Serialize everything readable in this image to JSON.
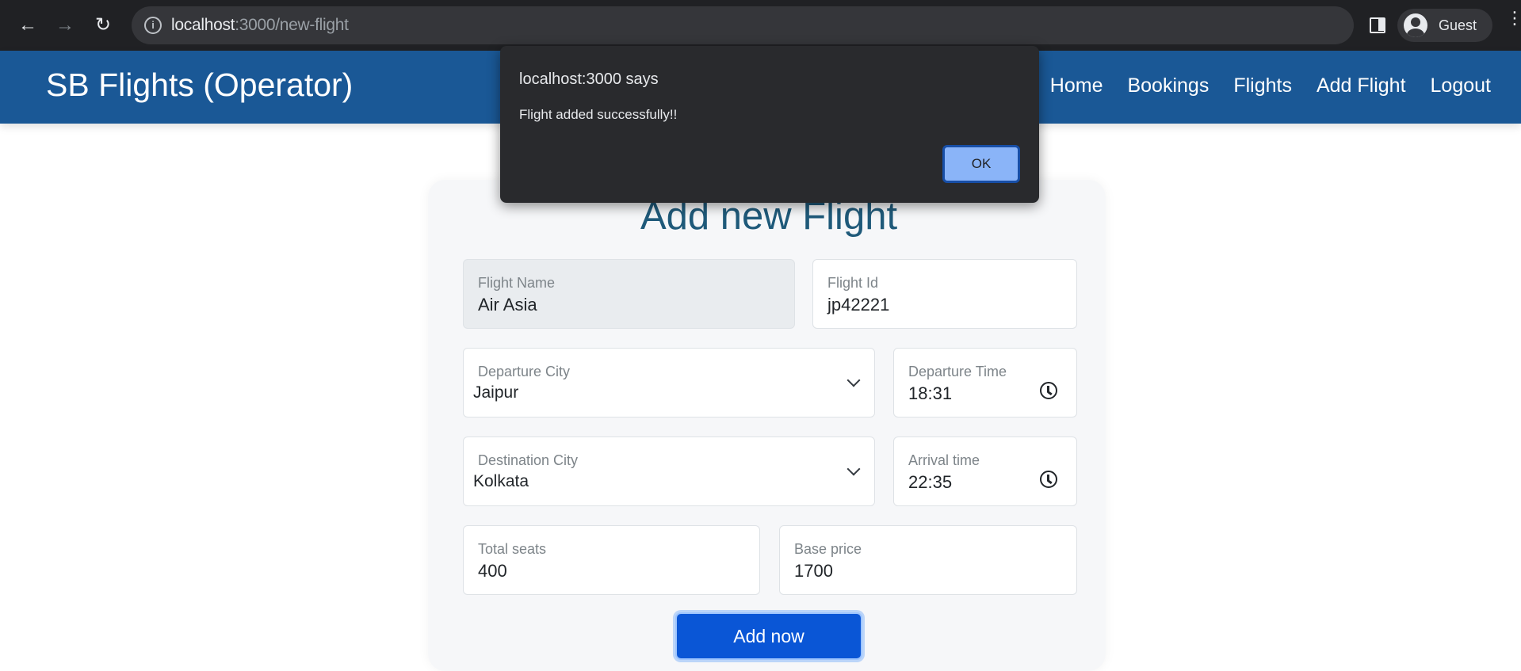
{
  "browser": {
    "url_host": "localhost",
    "url_rest": ":3000/new-flight",
    "profile_name": "Guest"
  },
  "navbar": {
    "brand": "SB Flights (Operator)",
    "links": [
      "Home",
      "Bookings",
      "Flights",
      "Add Flight",
      "Logout"
    ]
  },
  "form": {
    "title": "Add new Flight",
    "flight_name": {
      "label": "Flight Name",
      "value": "Air Asia"
    },
    "flight_id": {
      "label": "Flight Id",
      "value": "jp42221"
    },
    "departure_city": {
      "label": "Departure City",
      "value": "Jaipur"
    },
    "departure_time": {
      "label": "Departure Time",
      "value": "18:31"
    },
    "destination_city": {
      "label": "Destination City",
      "value": "Kolkata"
    },
    "arrival_time": {
      "label": "Arrival time",
      "value": "22:35"
    },
    "total_seats": {
      "label": "Total seats",
      "value": "400"
    },
    "base_price": {
      "label": "Base price",
      "value": "1700"
    },
    "submit_label": "Add now"
  },
  "dialog": {
    "origin": "localhost:3000 says",
    "message": "Flight added successfully!!",
    "ok_label": "OK"
  },
  "colors": {
    "navbar": "#1a5896",
    "title": "#1f5a7a",
    "button": "#0a56d6",
    "dialog_ok": "#8ab4f8"
  }
}
